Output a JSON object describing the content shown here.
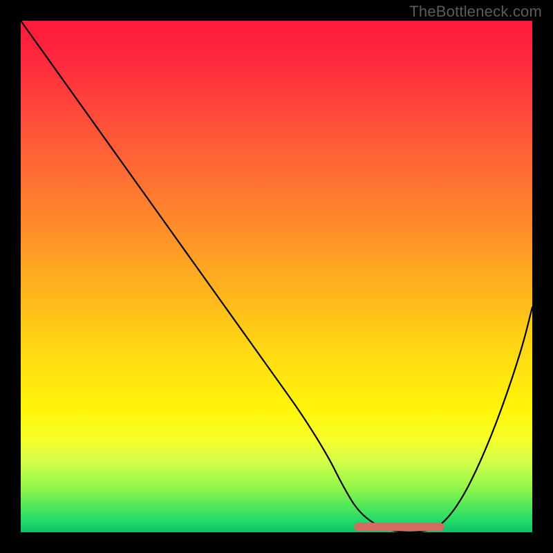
{
  "watermark": "TheBottleneck.com",
  "chart_data": {
    "type": "line",
    "title": "",
    "xlabel": "",
    "ylabel": "",
    "xlim": [
      0,
      100
    ],
    "ylim": [
      0,
      100
    ],
    "curve": {
      "x": [
        0,
        5,
        10,
        15,
        20,
        25,
        30,
        35,
        40,
        45,
        50,
        55,
        60,
        63,
        66,
        70,
        74,
        78,
        82,
        86,
        90,
        94,
        98,
        100
      ],
      "y_pct": [
        100,
        93,
        86,
        79,
        72,
        65,
        58,
        51,
        44,
        37,
        30,
        23,
        15,
        9,
        4,
        1,
        0,
        0,
        1,
        6,
        14,
        24,
        36,
        44
      ]
    },
    "optimal_flat_region": {
      "x_start": 66,
      "x_end": 82,
      "y_pct": 0.5
    },
    "colors": {
      "gradient_top": "#ff1a3c",
      "gradient_mid1": "#ff9228",
      "gradient_mid2": "#fff50a",
      "gradient_bottom": "#0fc06a",
      "curve": "#000000",
      "flat_marker": "#d46a60",
      "frame": "#000000",
      "watermark": "#5c5c5c"
    }
  }
}
